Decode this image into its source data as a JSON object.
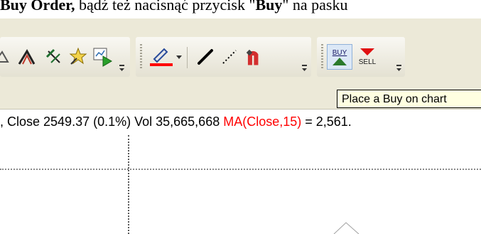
{
  "doc_text": {
    "prefix": "Buy Order",
    "comma": ",",
    "rest": " bądź też nacisnąć przycisk \"",
    "buy_bold": "Buy",
    "tail": "\" na pasku"
  },
  "toolbar1": {
    "tools": [
      "draw-fan-icon",
      "draw-pitchfork-icon",
      "wizard-icon",
      "replay-icon"
    ]
  },
  "toolbar2": {
    "tools": [
      "pen-color-icon",
      "line-icon",
      "dotted-line-icon",
      "magnet-icon"
    ],
    "pen_color": "#ff0000"
  },
  "toolbar3": {
    "buy_label": "BUY",
    "sell_label": "SELL",
    "buy_color": "#2b7a2b",
    "sell_color": "#e01010"
  },
  "tooltip": {
    "text": "Place a Buy on chart"
  },
  "info_line": {
    "close": ", Close 2549.37 (0.1%) Vol 35,665,668 ",
    "ma_label": "MA(Close,15)",
    "ma_value": " = 2,561."
  }
}
